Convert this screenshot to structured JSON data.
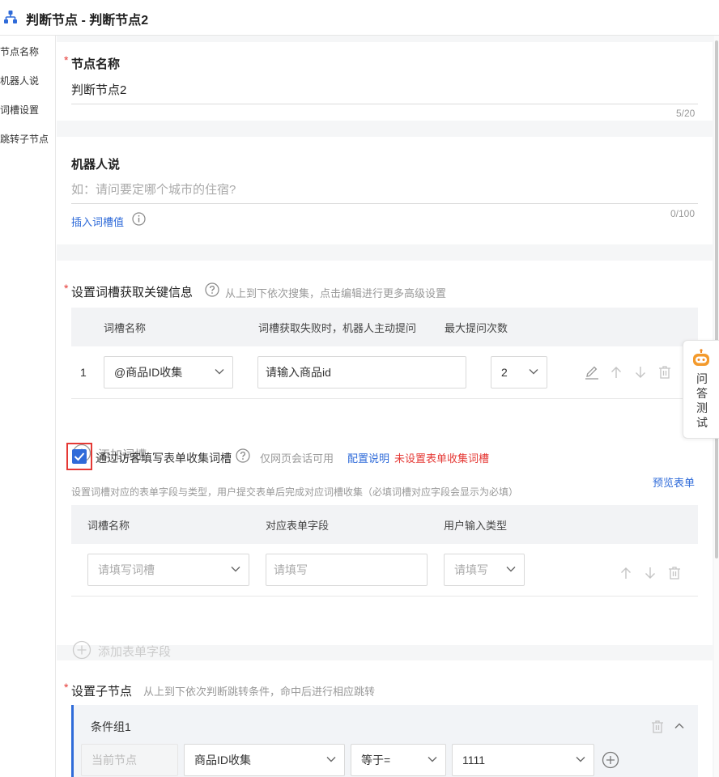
{
  "title": "判断节点 - 判断节点2",
  "sidenav": [
    "节点名称",
    "机器人说",
    "词槽设置",
    "跳转子节点"
  ],
  "node_name": {
    "label": "节点名称",
    "required_mark": "*",
    "value": "判断节点2",
    "counter": "5/20"
  },
  "robot_say": {
    "label": "机器人说",
    "placeholder": "如：请问要定哪个城市的住宿?",
    "insert_link": "插入词槽值",
    "counter": "0/100"
  },
  "slot_settings": {
    "required_mark": "*",
    "label": "设置词槽获取关键信息",
    "hint": "从上到下依次搜集，点击编辑进行更多高级设置",
    "headers": [
      "词槽名称",
      "词槽获取失败时，机器人主动提问",
      "最大提问次数"
    ],
    "rows": [
      {
        "index": "1",
        "slot": "@商品ID收集",
        "prompt_placeholder": "请输入商品id",
        "max_count": "2"
      }
    ],
    "add_slot": "添加词槽"
  },
  "form_collect": {
    "checked": true,
    "label": "通过访客填写表单收集词槽",
    "hint": "仅网页会话可用",
    "config_link": "配置说明",
    "warning": "未设置表单收集词槽",
    "desc": "设置词槽对应的表单字段与类型，用户提交表单后完成对应词槽收集（必填词槽对应字段会显示为必填）",
    "preview": "预览表单",
    "headers": [
      "词槽名称",
      "对应表单字段",
      "用户输入类型"
    ],
    "row": {
      "slot_placeholder": "请填写词槽",
      "field_placeholder": "请填写",
      "type_placeholder": "请填写"
    },
    "add_field": "添加表单字段"
  },
  "child_nodes": {
    "required_mark": "*",
    "label": "设置子节点",
    "hint": "从上到下依次判断跳转条件，命中后进行相应跳转",
    "group": {
      "name": "条件组1",
      "current_node": "当前节点",
      "slot": "商品ID收集",
      "operator": "等于=",
      "value": "1111"
    }
  },
  "float_test": "问答测试",
  "colors": {
    "accent": "#2f6bd9",
    "required": "#e53935",
    "bg": "#f5f6f7"
  }
}
